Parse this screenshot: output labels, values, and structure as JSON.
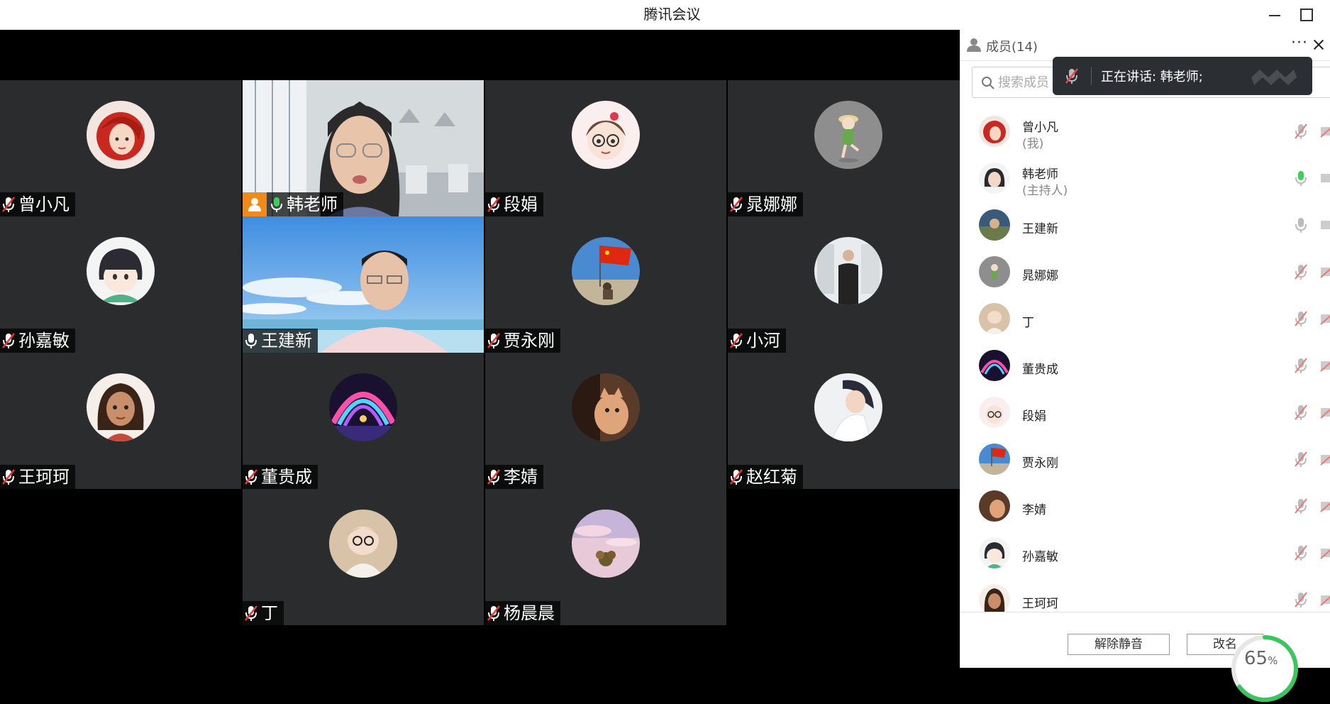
{
  "window": {
    "title": "腾讯会议"
  },
  "tiles": [
    {
      "name": "曾小凡",
      "mic": "muted"
    },
    {
      "name": "韩老师",
      "mic": "on",
      "host": true
    },
    {
      "name": "段娟",
      "mic": "muted"
    },
    {
      "name": "晁娜娜",
      "mic": "muted"
    },
    {
      "name": "孙嘉敏",
      "mic": "muted"
    },
    {
      "name": "王建新",
      "mic": "idle"
    },
    {
      "name": "贾永刚",
      "mic": "muted"
    },
    {
      "name": "小河",
      "mic": "muted"
    },
    {
      "name": "王珂珂",
      "mic": "muted"
    },
    {
      "name": "董贵成",
      "mic": "muted"
    },
    {
      "name": "李婧",
      "mic": "muted"
    },
    {
      "name": "赵红菊",
      "mic": "muted"
    },
    {
      "name": "丁",
      "mic": "muted"
    },
    {
      "name": "杨晨晨",
      "mic": "muted"
    }
  ],
  "panel": {
    "title": "成员(14)",
    "search_placeholder": "搜索成员",
    "speaking": "正在讲话: 韩老师;",
    "members": [
      {
        "name": "曾小凡",
        "sub": "(我)",
        "mic": "muted"
      },
      {
        "name": "韩老师",
        "sub": "(主持人)",
        "mic": "on"
      },
      {
        "name": "王建新",
        "sub": "",
        "mic": "idle"
      },
      {
        "name": "晁娜娜",
        "sub": "",
        "mic": "muted"
      },
      {
        "name": "丁",
        "sub": "",
        "mic": "muted"
      },
      {
        "name": "董贵成",
        "sub": "",
        "mic": "muted"
      },
      {
        "name": "段娟",
        "sub": "",
        "mic": "muted"
      },
      {
        "name": "贾永刚",
        "sub": "",
        "mic": "muted"
      },
      {
        "name": "李婧",
        "sub": "",
        "mic": "muted"
      },
      {
        "name": "孙嘉敏",
        "sub": "",
        "mic": "muted"
      },
      {
        "name": "王珂珂",
        "sub": "",
        "mic": "muted"
      }
    ],
    "unmute_label": "解除静音",
    "rename_label": "改名",
    "progress": {
      "value": "65",
      "unit": "%"
    }
  },
  "colors": {
    "mic_on": "#3ccf5a",
    "host_badge": "#f08a19",
    "tile_bg": "#2a2c2e"
  }
}
